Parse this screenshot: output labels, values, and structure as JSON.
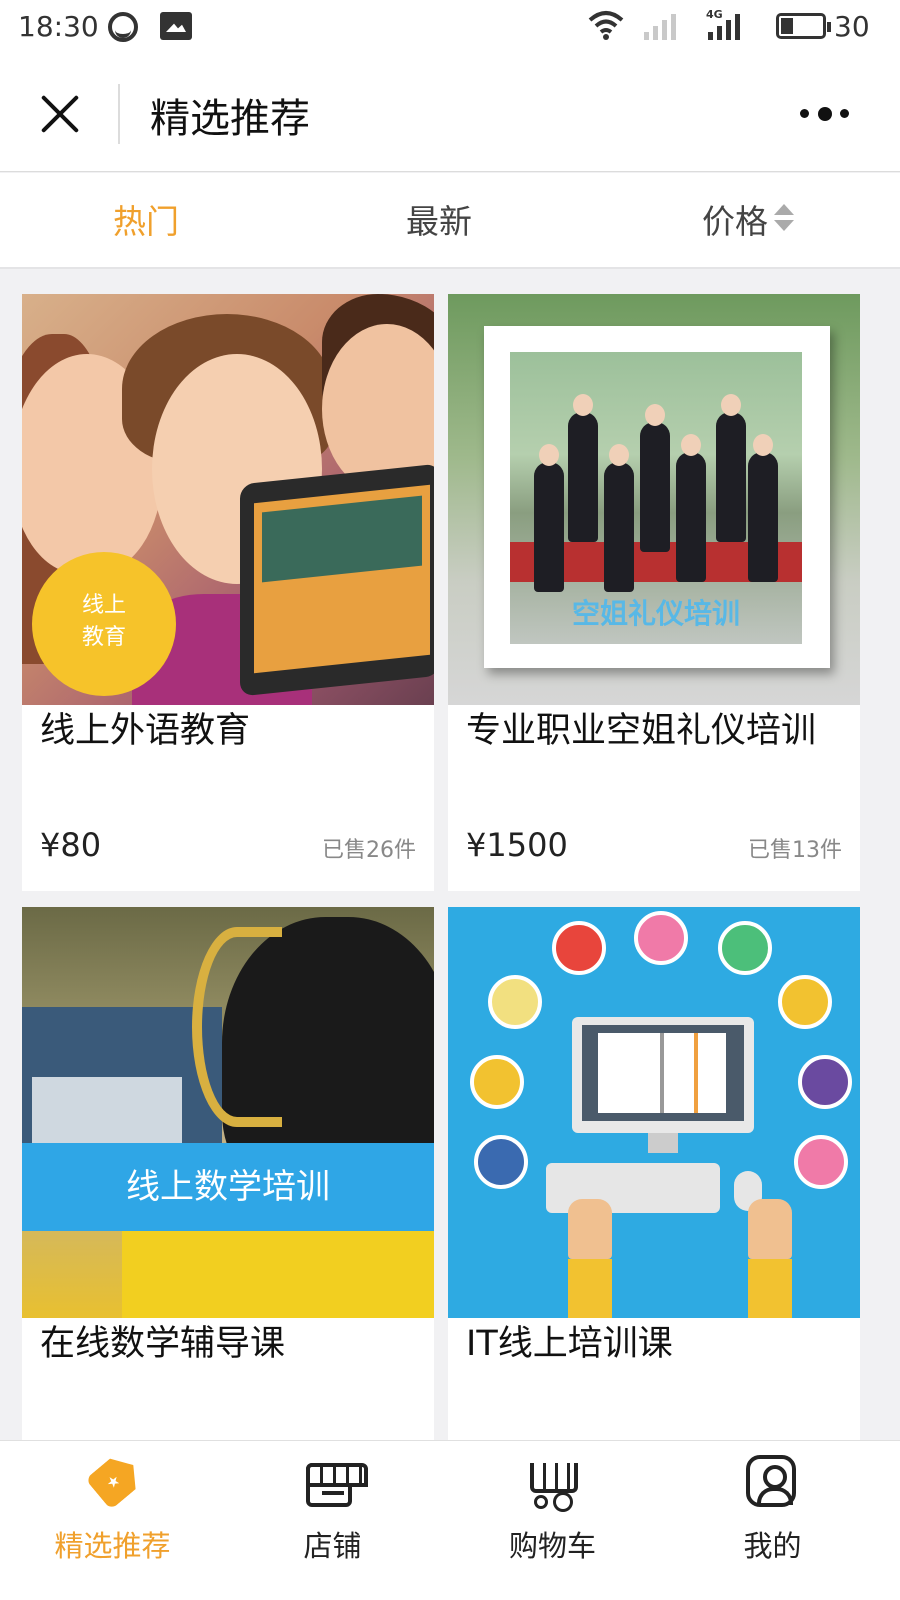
{
  "status_bar": {
    "time": "18:30",
    "network": "4G",
    "battery": "30"
  },
  "header": {
    "title": "精选推荐",
    "close_icon": "close-icon",
    "more_icon": "more-icon"
  },
  "tabs": [
    {
      "label": "热门",
      "active": true
    },
    {
      "label": "最新",
      "active": false
    },
    {
      "label": "价格",
      "active": false,
      "sortable": true
    }
  ],
  "products": [
    {
      "name": "线上外语教育",
      "price": "¥80",
      "sold": "已售26件",
      "badge": "线上\n教育"
    },
    {
      "name": "专业职业空姐礼仪培训",
      "price": "¥1500",
      "sold": "已售13件",
      "image_caption": "空姐礼仪培训"
    },
    {
      "name": "在线数学辅导课",
      "image_caption": "线上数学培训"
    },
    {
      "name": "IT线上培训课"
    }
  ],
  "bottom_nav": [
    {
      "label": "精选推荐",
      "icon": "tag-icon",
      "active": true
    },
    {
      "label": "店铺",
      "icon": "store-icon",
      "active": false
    },
    {
      "label": "购物车",
      "icon": "cart-icon",
      "active": false
    },
    {
      "label": "我的",
      "icon": "user-icon",
      "active": false
    }
  ],
  "colors": {
    "accent": "#f0a02c",
    "background": "#f1f1f3",
    "banner_blue": "#2fa6e6",
    "badge_yellow": "#f6c32a"
  }
}
